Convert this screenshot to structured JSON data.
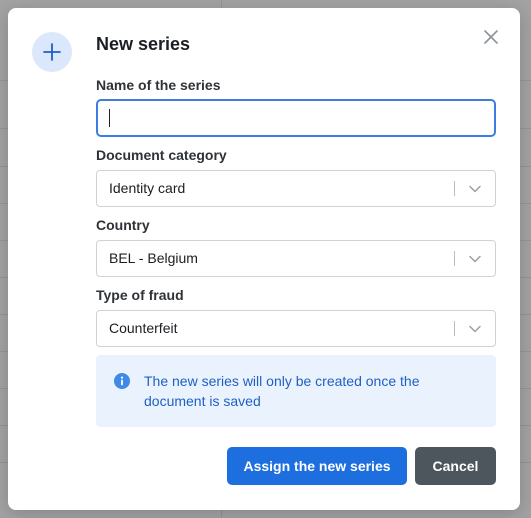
{
  "modal": {
    "title": "New series",
    "icon": "plus-icon",
    "close_icon": "close-icon"
  },
  "form": {
    "name": {
      "label": "Name of the series",
      "value": ""
    },
    "document_category": {
      "label": "Document category",
      "value": "Identity card"
    },
    "country": {
      "label": "Country",
      "value": "BEL - Belgium"
    },
    "fraud_type": {
      "label": "Type of fraud",
      "value": "Counterfeit"
    }
  },
  "info": {
    "icon": "info-icon",
    "text": "The new series will only be created once the document is saved"
  },
  "actions": {
    "assign_label": "Assign the new series",
    "cancel_label": "Cancel"
  },
  "colors": {
    "primary": "#1d6fe0",
    "secondary": "#4d555d",
    "info_bg": "#eaf3fd",
    "info_text": "#1f5fc4",
    "focus_border": "#3b7de3"
  }
}
